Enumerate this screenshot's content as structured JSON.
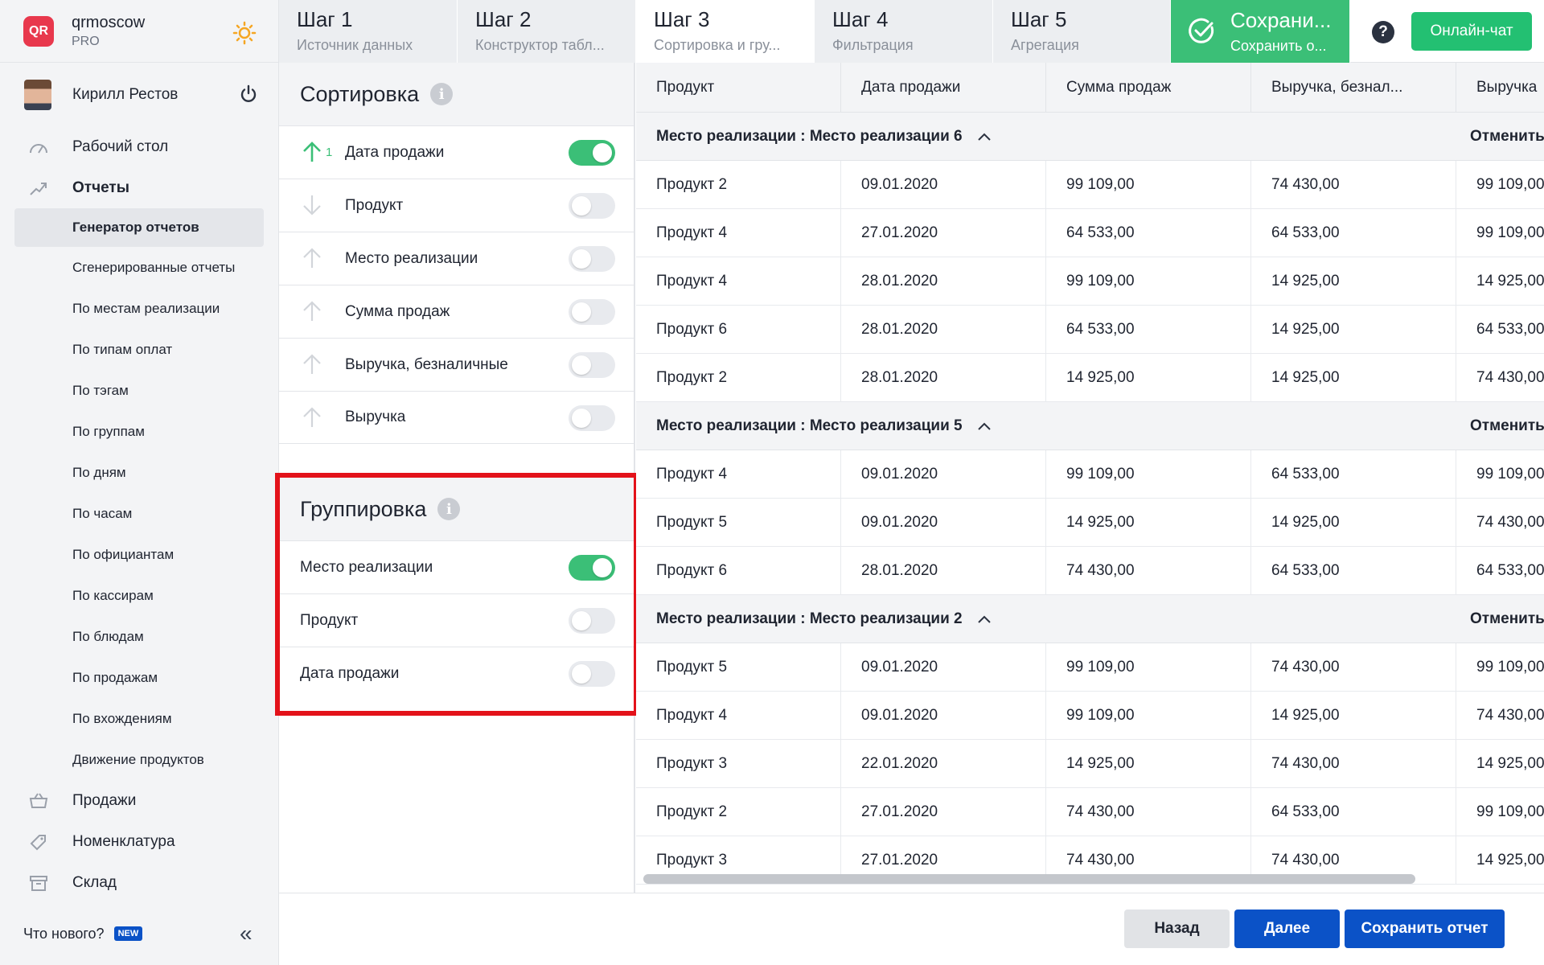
{
  "app": {
    "logo_text": "QR",
    "name": "qrmoscow",
    "plan": "PRO",
    "user_name": "Кирилл Рестов"
  },
  "sidebar": {
    "main_items": [
      {
        "label": "Рабочий стол",
        "icon": "dashboard-icon"
      },
      {
        "label": "Отчеты",
        "icon": "reports-icon"
      }
    ],
    "report_items": [
      "Генератор отчетов",
      "Сгенерированные отчеты",
      "По местам реализации",
      "По типам оплат",
      "По тэгам",
      "По группам",
      "По дням",
      "По часам",
      "По официантам",
      "По кассирам",
      "По блюдам",
      "По продажам",
      "По вхождениям",
      "Движение продуктов"
    ],
    "bottom_items": [
      {
        "label": "Продажи",
        "icon": "basket-icon"
      },
      {
        "label": "Номенклатура",
        "icon": "tag-icon"
      },
      {
        "label": "Склад",
        "icon": "box-icon"
      }
    ],
    "footer_label": "Что нового?",
    "footer_badge": "NEW"
  },
  "steps": [
    {
      "title": "Шаг 1",
      "subtitle": "Источник данных"
    },
    {
      "title": "Шаг 2",
      "subtitle": "Конструктор табл..."
    },
    {
      "title": "Шаг 3",
      "subtitle": "Сортировка и гру..."
    },
    {
      "title": "Шаг 4",
      "subtitle": "Фильтрация"
    },
    {
      "title": "Шаг 5",
      "subtitle": "Агрегация"
    }
  ],
  "save_step": {
    "title": "Сохрани...",
    "subtitle": "Сохранить о..."
  },
  "help_label": "?",
  "chat_label": "Онлайн-чат",
  "sorting": {
    "title": "Сортировка",
    "info": "i",
    "rows": [
      {
        "label": "Дата продажи",
        "order": "1",
        "on": true
      },
      {
        "label": "Продукт",
        "order": "",
        "on": false
      },
      {
        "label": "Место реализации",
        "order": "",
        "on": false
      },
      {
        "label": "Сумма продаж",
        "order": "",
        "on": false
      },
      {
        "label": "Выручка, безналичные",
        "order": "",
        "on": false
      },
      {
        "label": "Выручка",
        "order": "",
        "on": false
      }
    ]
  },
  "grouping": {
    "title": "Группировка",
    "info": "i",
    "rows": [
      {
        "label": "Место реализации",
        "on": true
      },
      {
        "label": "Продукт",
        "on": false
      },
      {
        "label": "Дата продажи",
        "on": false
      }
    ]
  },
  "table": {
    "columns": [
      "Продукт",
      "Дата продажи",
      "Сумма продаж",
      "Выручка, безнал...",
      "Выручка"
    ],
    "cancel_label": "Отменить",
    "groups": [
      {
        "title": "Место реализации : Место реализации 6",
        "rows": [
          [
            "Продукт 2",
            "09.01.2020",
            "99 109,00",
            "74 430,00",
            "99 109,00"
          ],
          [
            "Продукт 4",
            "27.01.2020",
            "64 533,00",
            "64 533,00",
            "99 109,00"
          ],
          [
            "Продукт 4",
            "28.01.2020",
            "99 109,00",
            "14 925,00",
            "14 925,00"
          ],
          [
            "Продукт 6",
            "28.01.2020",
            "64 533,00",
            "14 925,00",
            "64 533,00"
          ],
          [
            "Продукт 2",
            "28.01.2020",
            "14 925,00",
            "14 925,00",
            "74 430,00"
          ]
        ]
      },
      {
        "title": "Место реализации : Место реализации 5",
        "rows": [
          [
            "Продукт 4",
            "09.01.2020",
            "99 109,00",
            "64 533,00",
            "99 109,00"
          ],
          [
            "Продукт 5",
            "09.01.2020",
            "14 925,00",
            "14 925,00",
            "74 430,00"
          ],
          [
            "Продукт 6",
            "28.01.2020",
            "74 430,00",
            "64 533,00",
            "64 533,00"
          ]
        ]
      },
      {
        "title": "Место реализации : Место реализации 2",
        "rows": [
          [
            "Продукт 5",
            "09.01.2020",
            "99 109,00",
            "74 430,00",
            "99 109,00"
          ],
          [
            "Продукт 4",
            "09.01.2020",
            "99 109,00",
            "14 925,00",
            "74 430,00"
          ],
          [
            "Продукт 3",
            "22.01.2020",
            "14 925,00",
            "74 430,00",
            "14 925,00"
          ],
          [
            "Продукт 2",
            "27.01.2020",
            "74 430,00",
            "64 533,00",
            "99 109,00"
          ],
          [
            "Продукт 3",
            "27.01.2020",
            "74 430,00",
            "74 430,00",
            "14 925,00"
          ]
        ]
      }
    ]
  },
  "footer": {
    "back": "Назад",
    "next": "Далее",
    "save": "Сохранить отчет"
  },
  "colors": {
    "accent_green": "#3bbf77",
    "primary_blue": "#0b52c7",
    "highlight_red": "#e3121a",
    "logo_red": "#e8384d"
  }
}
